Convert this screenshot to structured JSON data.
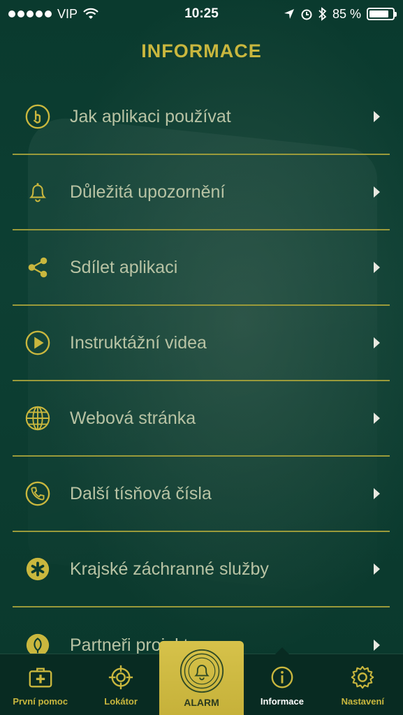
{
  "statusbar": {
    "carrier": "VIP",
    "time": "10:25",
    "battery": "85 %",
    "battery_level": 0.85
  },
  "header": {
    "title": "INFORMACE"
  },
  "menu": [
    {
      "label": "Jak aplikaci používat",
      "icon": "touch-icon"
    },
    {
      "label": "Důležitá upozornění",
      "icon": "bell-icon"
    },
    {
      "label": "Sdílet aplikaci",
      "icon": "share-icon"
    },
    {
      "label": "Instruktážní videa",
      "icon": "play-icon"
    },
    {
      "label": "Webová stránka",
      "icon": "globe-icon"
    },
    {
      "label": "Další tísňová čísla",
      "icon": "phone-icon"
    },
    {
      "label": "Krajské záchranné služby",
      "icon": "star-of-life-icon"
    },
    {
      "label": "Partneři projektu",
      "icon": "leaf-icon"
    }
  ],
  "tabbar": {
    "first_aid": "První pomoc",
    "locator": "Lokátor",
    "alarm": "ALARM",
    "info": "Informace",
    "settings": "Nastavení"
  },
  "colors": {
    "accent": "#c9b73e",
    "background": "#0b3a2e",
    "label": "#b8c3a4"
  }
}
